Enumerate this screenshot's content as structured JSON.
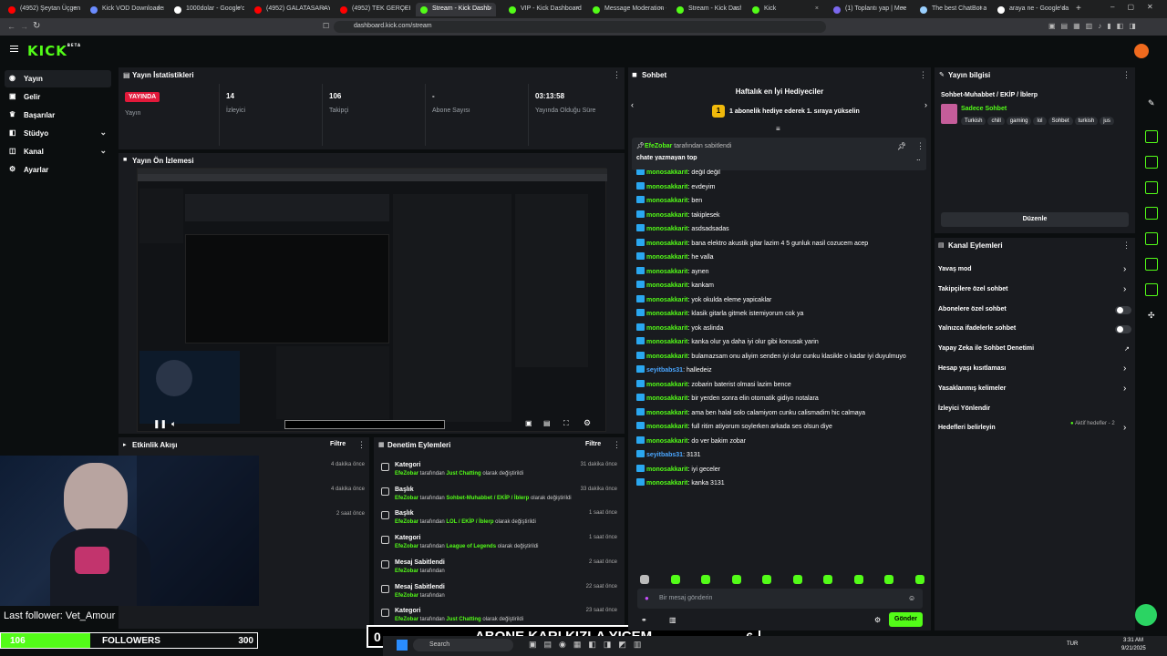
{
  "browser": {
    "tabs": [
      {
        "label": "(4952) Şeytan Üçgeni - Y",
        "fav": "#ff0000"
      },
      {
        "label": "Kick VOD Downloader - Fr",
        "fav": "#6b8cff"
      },
      {
        "label": "1000dolar - Google'da A",
        "fav": "#ffffff"
      },
      {
        "label": "(4952) GALATASARAY'IN",
        "fav": "#ff0000"
      },
      {
        "label": "(4952) TEK GERÇEK KRAL",
        "fav": "#ff0000"
      },
      {
        "label": "Stream - Kick Dashb",
        "fav": "#53fc18"
      },
      {
        "label": "VIP - Kick Dashboard",
        "fav": "#53fc18"
      },
      {
        "label": "Message Moderation - K",
        "fav": "#53fc18"
      },
      {
        "label": "Stream - Kick Dashboard",
        "fav": "#53fc18"
      },
      {
        "label": "Kick",
        "fav": "#53fc18"
      },
      {
        "label": "(1) Toplantı yap | Mee",
        "fav": "#7b68ee"
      },
      {
        "label": "The best ChatBot and W",
        "fav": "#9ad0ff"
      },
      {
        "label": "araya ne - Google'da A",
        "fav": "#ffffff"
      }
    ],
    "url": "dashboard.kick.com/stream"
  },
  "header": {
    "logo": "KICK",
    "logo_sup": "BETA"
  },
  "sidebar": {
    "items": [
      {
        "label": "Yayın",
        "icon": "broadcast-icon"
      },
      {
        "label": "Gelir",
        "icon": "dollar-icon"
      },
      {
        "label": "Başarılar",
        "icon": "trophy-icon"
      },
      {
        "label": "Stüdyo",
        "icon": "studio-icon"
      },
      {
        "label": "Kanal",
        "icon": "channel-icon"
      },
      {
        "label": "Ayarlar",
        "icon": "gear-icon"
      }
    ]
  },
  "stats": {
    "title": "Yayın İstatistikleri",
    "live_badge": "YAYINDA",
    "live_label": "Yayın",
    "viewers_value": "14",
    "viewers_label": "İzleyici",
    "followers_value": "106",
    "followers_label": "Takipçi",
    "subs_value": "-",
    "subs_label": "Abone Sayısı",
    "uptime_value": "03:13:58",
    "uptime_label": "Yayında Olduğu Süre"
  },
  "preview": {
    "title": "Yayın Ön İzlemesi",
    "goal_left": "0",
    "goal_text": "ABONE KARI KIZLA YICEM",
    "goal_right": "6",
    "last_follower": "Last follower: Vet_Amour",
    "followers_left": "106",
    "followers_text": "FOLLOWERS",
    "followers_right": "300"
  },
  "activity": {
    "title": "Etkinlik Akışı",
    "filter": "Filtre",
    "times": [
      "4 dakika önce",
      "4 dakika önce",
      "2 saat önce"
    ]
  },
  "moderation": {
    "title": "Denetim Eylemleri",
    "filter": "Filtre",
    "rows": [
      {
        "title": "Kategori",
        "user": "EfeZobar",
        "mid": " tarafından ",
        "target": "Just Chatting",
        "end": " olarak değiştirildi",
        "time": "31 dakika önce"
      },
      {
        "title": "Başlık",
        "user": "EfeZobar",
        "mid": " tarafından ",
        "target": "Sohbet-Muhabbet / EKİP / İblerp",
        "end": " olarak değiştirildi",
        "time": "33 dakika önce"
      },
      {
        "title": "Başlık",
        "user": "EfeZobar",
        "mid": " tarafından ",
        "target": "LOL / EKİP / İblerp",
        "end": " olarak değiştirildi",
        "time": "1 saat önce"
      },
      {
        "title": "Kategori",
        "user": "EfeZobar",
        "mid": " tarafından ",
        "target": "League of Legends",
        "end": " olarak değiştirildi",
        "time": "1 saat önce"
      },
      {
        "title": "Mesaj Sabitlendi",
        "user": "EfeZobar",
        "mid": " tarafından",
        "target": "",
        "end": "",
        "time": "2 saat önce"
      },
      {
        "title": "Mesaj Sabitlendi",
        "user": "EfeZobar",
        "mid": " tarafından",
        "target": "",
        "end": "",
        "time": "22 saat önce"
      },
      {
        "title": "Kategori",
        "user": "EfeZobar",
        "mid": " tarafından ",
        "target": "Just Chatting",
        "end": " olarak değiştirildi",
        "time": "23 saat önce"
      }
    ]
  },
  "chat": {
    "title": "Sohbet",
    "gifters_title": "Haftalık en İyi Hediyeciler",
    "gifters_rank": "1",
    "gifters_text": "1 abonelik hediye ederek 1. sıraya yükselin",
    "pinned_user": "EfeZobar",
    "pinned_suffix": " tarafından sabitlendi",
    "pinned_text": "chate yazmayan top",
    "messages": [
      {
        "user": "monosakkarit",
        "text": "değil değil"
      },
      {
        "user": "monosakkarit",
        "text": "evdeyim"
      },
      {
        "user": "monosakkarit",
        "text": "ben"
      },
      {
        "user": "monosakkarit",
        "text": "takiplesek"
      },
      {
        "user": "monosakkarit",
        "text": "asdsadsadas"
      },
      {
        "user": "monosakkarit",
        "text": "bana elektro akustik gitar lazim 4 5 gunluk nasil cozucem acep"
      },
      {
        "user": "monosakkarit",
        "text": "he valla"
      },
      {
        "user": "monosakkarit",
        "text": "aynen"
      },
      {
        "user": "monosakkarit",
        "text": "kankam"
      },
      {
        "user": "monosakkarit",
        "text": "yok okulda eleme yapicaklar"
      },
      {
        "user": "monosakkarit",
        "text": "klasik gitarla gitmek istemiyorum cok ya"
      },
      {
        "user": "monosakkarit",
        "text": "yok aslinda"
      },
      {
        "user": "monosakkarit",
        "text": "kanka olur ya daha iyi olur gibi konusak yarin"
      },
      {
        "user": "monosakkarit",
        "text": "bulamazsam onu aliyim senden iyi olur cunku klasikle o kadar iyi duyulmuyo"
      },
      {
        "user": "seyitbabs31",
        "text": "halledeiz",
        "blue": true
      },
      {
        "user": "monosakkarit",
        "text": "zobarin baterist olmasi lazim bence"
      },
      {
        "user": "monosakkarit",
        "text": "bir yerden sonra elin otomatik gidiyo notalara"
      },
      {
        "user": "monosakkarit",
        "text": "ama ben halal solo calamiyom cunku calismadim hic calmaya"
      },
      {
        "user": "monosakkarit",
        "text": "full ritim atiyorum soylerken arkada ses olsun diye"
      },
      {
        "user": "monosakkarit",
        "text": "do ver bakim zobar"
      },
      {
        "user": "seyitbabs31",
        "text": "3131",
        "blue": true
      },
      {
        "user": "monosakkarit",
        "text": "iyi geceler"
      },
      {
        "user": "monosakkarit",
        "text": "kanka 3131"
      }
    ],
    "input_placeholder": "Bir mesaj gönderin",
    "send_label": "Gönder"
  },
  "stream_info": {
    "title": "Yayın bilgisi",
    "stream_title": "Sohbet-Muhabbet / EKİP / İblerp",
    "category": "Sadece Sohbet",
    "tags": [
      "Turkish",
      "chill",
      "gaming",
      "lol",
      "Sohbet",
      "turkish",
      "jus"
    ],
    "edit_label": "Düzenle"
  },
  "channel_actions": {
    "title": "Kanal Eylemleri",
    "items": [
      {
        "label": "Yavaş mod",
        "ctl": "chevron"
      },
      {
        "label": "Takipçilere özel sohbet",
        "ctl": "chevron"
      },
      {
        "label": "Abonelere özel sohbet",
        "ctl": "toggle"
      },
      {
        "label": "Yalnızca ifadelerle sohbet",
        "ctl": "toggle"
      },
      {
        "label": "Yapay Zeka ile Sohbet Denetimi",
        "ctl": "link"
      },
      {
        "label": "Hesap yaşı kısıtlaması",
        "ctl": "chevron"
      },
      {
        "label": "Yasaklanmış kelimeler",
        "ctl": "chevron"
      },
      {
        "label": "İzleyici Yönlendir",
        "ctl": "none"
      },
      {
        "label": "Hedefleri belirleyin",
        "ctl": "chevron"
      }
    ],
    "goals_status": "Aktif hedefler - 2"
  },
  "taskbar": {
    "search": "Search",
    "lang": "TUR",
    "time": "3:31 AM",
    "date": "9/21/2025"
  },
  "colors": {
    "accent": "#53fc18",
    "live": "#e2193a",
    "panel": "#191b1f",
    "bg": "#0b0e0f"
  }
}
